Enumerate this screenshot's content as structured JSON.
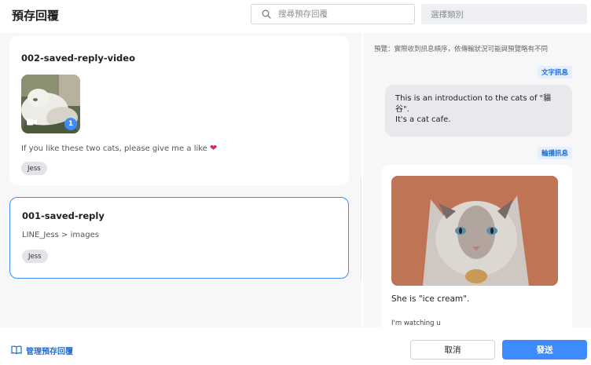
{
  "header": {
    "title": "預存回覆",
    "search_placeholder": "搜尋預存回覆",
    "category_placeholder": "選擇類別"
  },
  "saved_replies": [
    {
      "title": "002-saved-reply-video",
      "description": "If you like these two cats, please give me a like",
      "emoji": "❤",
      "tag": "Jess",
      "media_count": "1",
      "media_icon": "video-camera-icon"
    },
    {
      "title": "001-saved-reply",
      "description": "LINE_Jess > images",
      "tag": "Jess",
      "selected": true
    }
  ],
  "preview": {
    "note": "預覽：實際收到訊息順序，依傳輸狀況可能與預覽略有不同",
    "text_badge": "文字訊息",
    "text_message": "This is an introduction to the cats of \"貓谷\".\nIt's a cat cafe.",
    "carousel_badge": "輪播訊息",
    "carousel_text": "She is \"ice cream\".",
    "carousel_subtext": "I'm watching u"
  },
  "footer": {
    "manage_label": "管理預存回覆",
    "manage_icon": "book-icon",
    "cancel_label": "取消",
    "send_label": "發送"
  },
  "colors": {
    "accent": "#3d8bfd",
    "badge_bg": "#e4efff",
    "badge_text": "#1f6ed4"
  }
}
